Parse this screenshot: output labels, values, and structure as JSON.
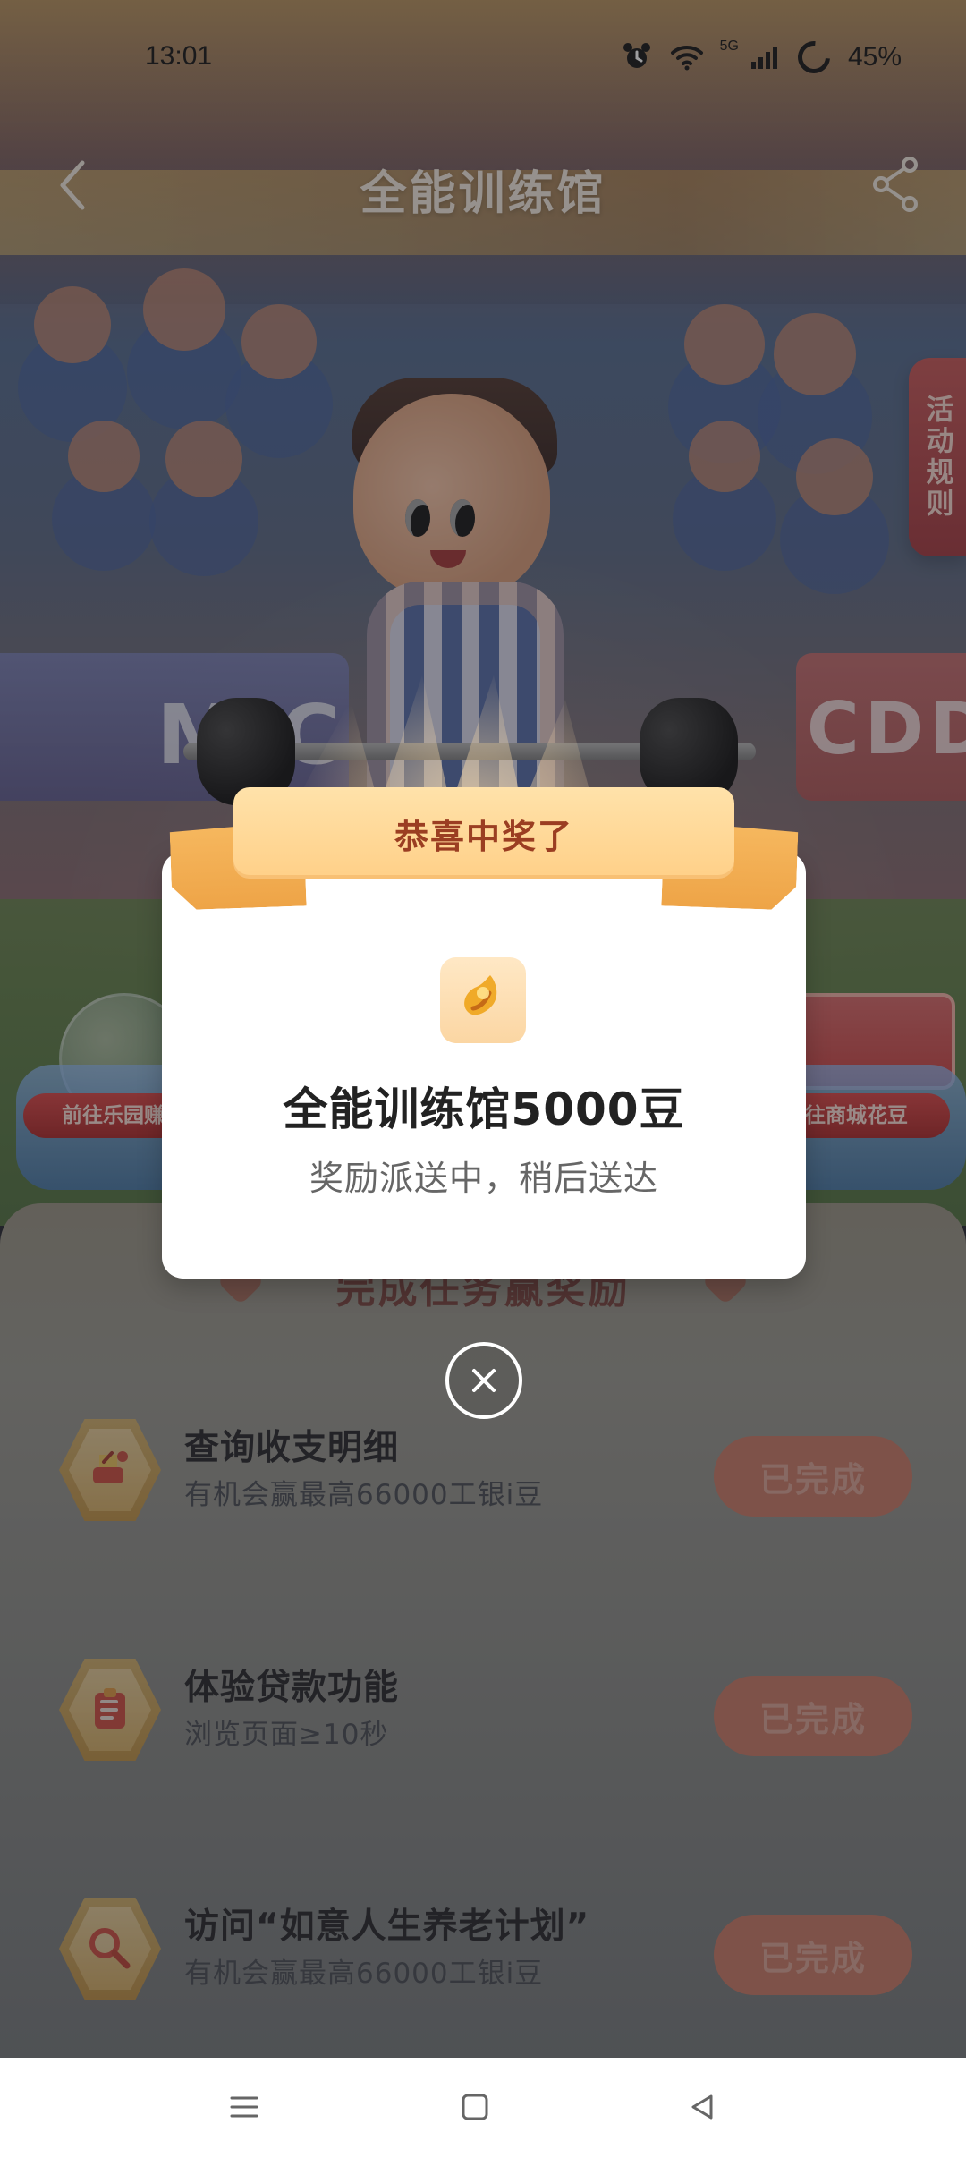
{
  "status_bar": {
    "time": "13:01",
    "network_label": "5G",
    "battery": "45%"
  },
  "header": {
    "title": "全能训练馆",
    "side_tab": "活动规则"
  },
  "scene": {
    "left_sign": "MIC",
    "right_sign": "CDD",
    "left_station_label": "前往乐园赚豆",
    "right_station_label": "前往商城花豆"
  },
  "modal": {
    "banner_title": "恭喜中奖了",
    "prize_title": "全能训练馆5000豆",
    "subtitle": "奖励派送中，稍后送达"
  },
  "task_panel": {
    "heading": "完成任务赢奖励",
    "tasks": [
      {
        "title": "查询收支明细",
        "desc": "有机会赢最高66000工银i豆",
        "button": "已完成",
        "icon": "bill-icon"
      },
      {
        "title": "体验贷款功能",
        "desc": "浏览页面≥10秒",
        "button": "已完成",
        "icon": "clipboard-icon"
      },
      {
        "title": "访问“如意人生养老计划”",
        "desc": "有机会赢最高66000工银i豆",
        "button": "已完成",
        "icon": "search-icon"
      }
    ]
  },
  "colors": {
    "accent_red": "#c85c5c",
    "banner_orange": "#ffd088",
    "task_button": "#c97d69",
    "modal_bg": "#ffffff"
  },
  "icons": {
    "back": "back-arrow-icon",
    "share": "share-icon",
    "close": "close-icon",
    "prize": "bean-icon",
    "nav_menu": "menu-icon",
    "nav_home": "home-icon",
    "nav_back": "back-triangle-icon"
  }
}
